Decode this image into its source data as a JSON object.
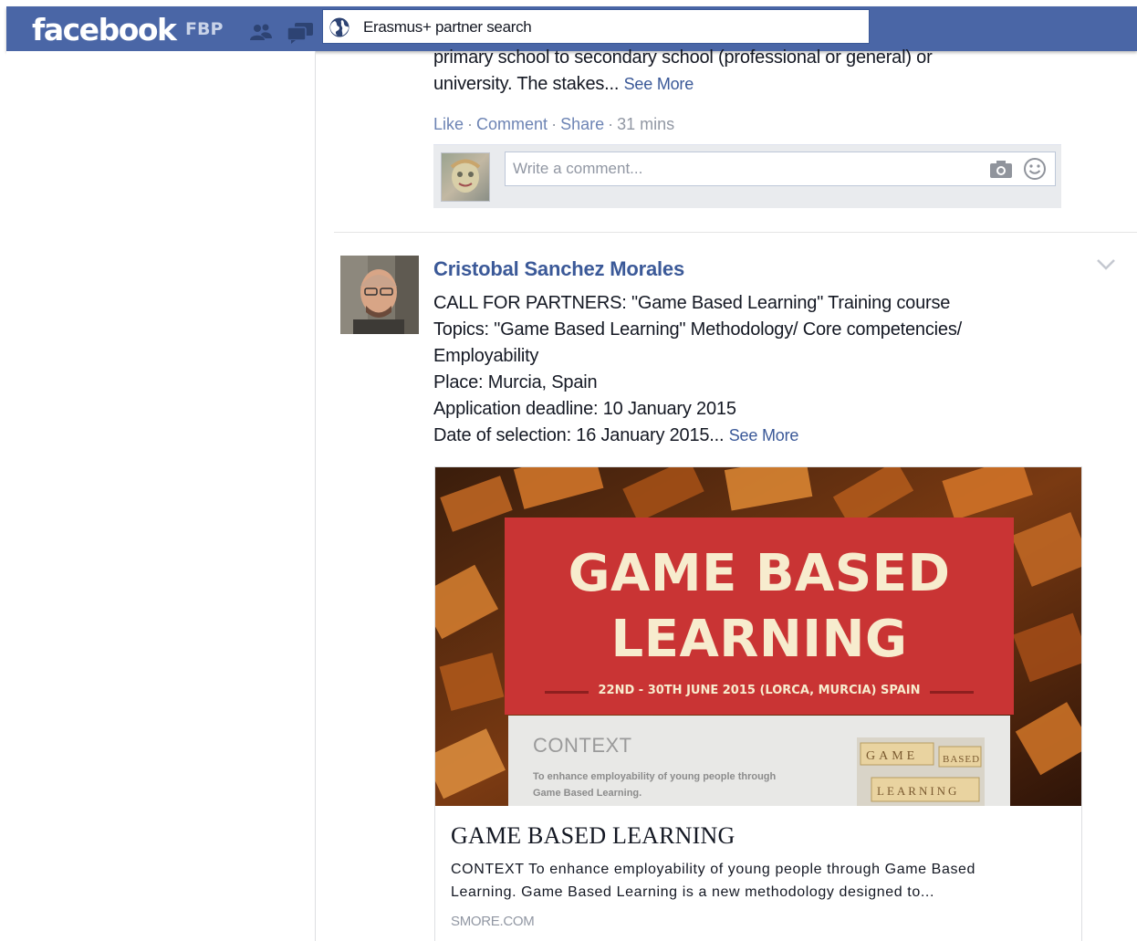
{
  "header": {
    "logo": "facebook",
    "badge": "FBP",
    "search_value": "Erasmus+ partner search",
    "icons": [
      "friends-icon",
      "messages-icon",
      "globe-icon"
    ],
    "bar_color": "#4a66a6"
  },
  "previous_post": {
    "text_lines": [
      "primary school to secondary school (professional or general) or",
      "university. The stakes..."
    ],
    "see_more": "See More",
    "actions": {
      "like": "Like",
      "comment": "Comment",
      "share": "Share",
      "time": "31 mins"
    },
    "comment_placeholder": "Write a comment...",
    "comment_icons": [
      "camera-icon",
      "smiley-icon"
    ]
  },
  "post": {
    "author": "Cristobal Sanchez Morales",
    "lines": [
      "CALL FOR PARTNERS: \"Game Based Learning\" Training course",
      "Topics: \"Game Based Learning\" Methodology/ Core competencies/",
      "Employability",
      "Place: Murcia, Spain",
      "Application deadline: 10 January 2015",
      "Date of selection: 16 January 2015..."
    ],
    "see_more": "See More",
    "link_color": "#3b5998",
    "preview": {
      "image": {
        "title_line1": "GAME BASED",
        "title_line2": "LEARNING",
        "dates": "22ND - 30TH JUNE 2015 (LORCA, MURCIA) SPAIN",
        "context_heading": "CONTEXT",
        "context_text_line1": "To enhance employability of young people through",
        "context_text_line2": "Game Based Learning.",
        "tile_row1": "GAME",
        "tile_row1b": "BASED",
        "tile_row2": "LEARNING",
        "panel_color": "#c93434"
      },
      "title": "GAME BASED LEARNING",
      "description_line1": "CONTEXT To enhance employability of young people through Game Based",
      "description_line2": "Learning. Game Based Learning is a new methodology designed to...",
      "domain": "SMORE.COM"
    }
  }
}
